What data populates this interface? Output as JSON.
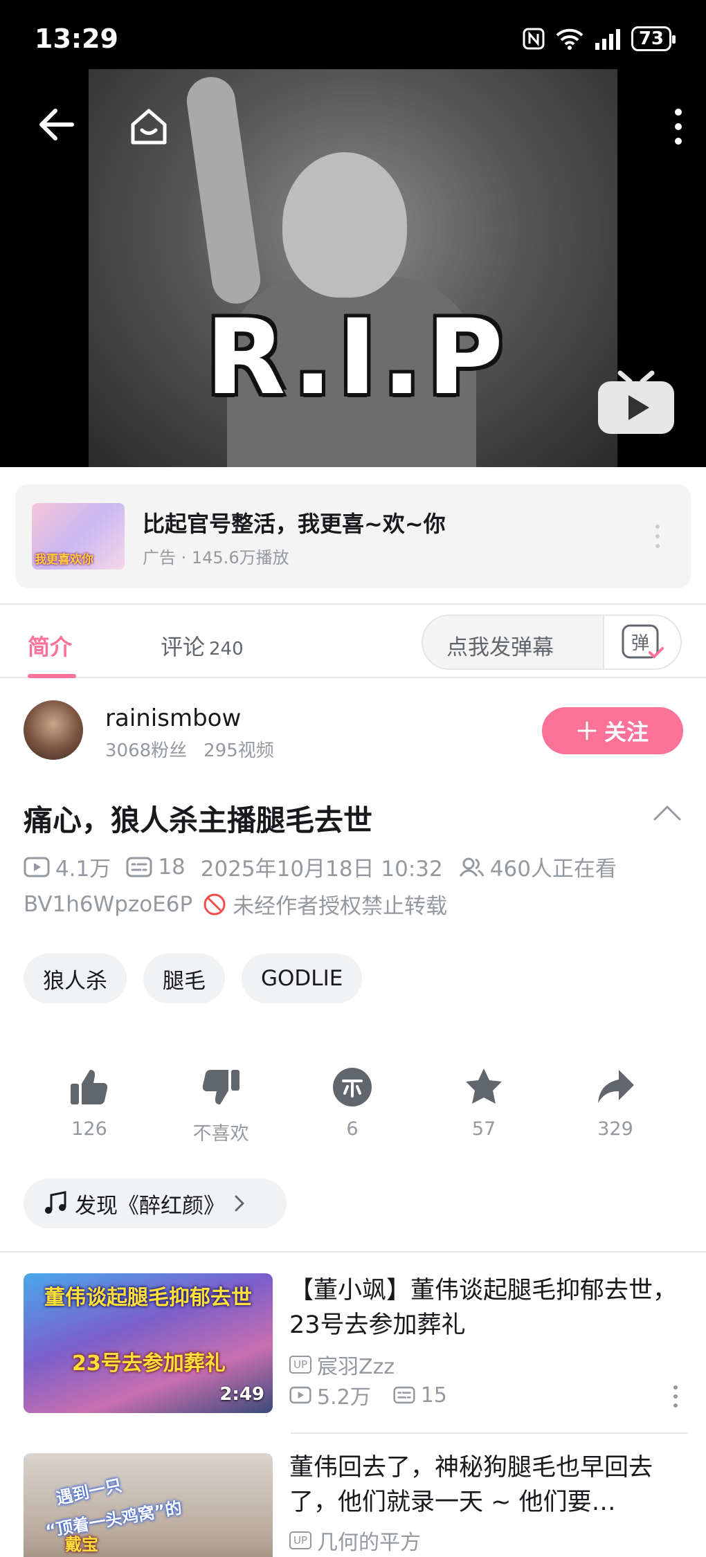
{
  "status_bar": {
    "time": "13:29",
    "battery": "73"
  },
  "video": {
    "overlay_text": "R.I.P"
  },
  "ad": {
    "thumb_caption": "我更喜欢你",
    "title": "比起官号整活，我更喜~欢~你",
    "subtitle": "广告 · 145.6万播放"
  },
  "tabs": {
    "intro": "简介",
    "comments": "评论",
    "comment_count": "240",
    "danmaku_placeholder": "点我发弹幕",
    "danmaku_button": "弹"
  },
  "uploader": {
    "name": "rainismbow",
    "fans": "3068粉丝",
    "videos": "295视频",
    "follow_label": "关注"
  },
  "video_info": {
    "title": "痛心，狼人杀主播腿毛去世",
    "views": "4.1万",
    "danmaku_count": "18",
    "datetime": "2025年10月18日 10:32",
    "watching": "460人正在看",
    "bvid": "BV1h6WpzoE6P",
    "copyright": "未经作者授权禁止转载"
  },
  "tags": [
    "狼人杀",
    "腿毛",
    "GODLIE"
  ],
  "actions": {
    "like": "126",
    "dislike": "不喜欢",
    "coin": "6",
    "favorite": "57",
    "share": "329"
  },
  "music": {
    "label": "发现《醉红颜》"
  },
  "recommendations": [
    {
      "thumb_top_text": "董伟谈起腿毛抑郁去世",
      "thumb_bottom_text": "23号去参加葬礼",
      "duration": "2:49",
      "title": "【董小飒】董伟谈起腿毛抑郁去世，23号去参加葬礼",
      "up_badge": "UP",
      "uploader": "宸羽Zzz",
      "views": "5.2万",
      "danmaku": "15"
    },
    {
      "thumb_text_1": "遇到一只",
      "thumb_text_2": "“顶着一头鸡窝”的",
      "thumb_text_3": "戴宝",
      "title": "董伟回去了，神秘狗腿毛也早回去了，他们就录一天 ~ 他们要…",
      "up_badge": "UP",
      "uploader": "几何的平方"
    }
  ],
  "colors": {
    "accent": "#fb7299",
    "secondary_text": "#9499a0",
    "chip_bg": "#f1f2f3"
  }
}
